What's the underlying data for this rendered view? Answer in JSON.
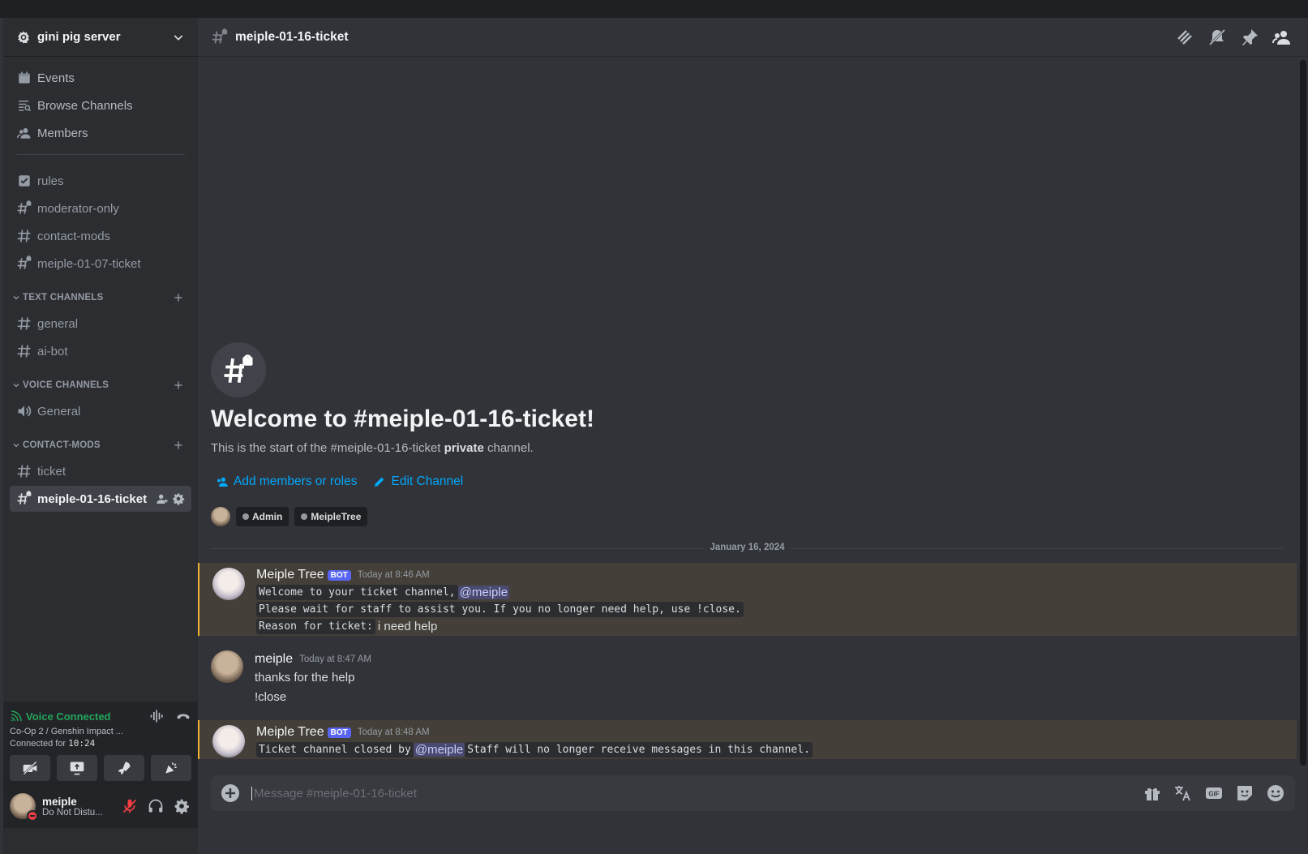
{
  "server": {
    "name": "gini pig server"
  },
  "nav": {
    "top_items": [
      {
        "label": "Events",
        "icon": "calendar-icon"
      },
      {
        "label": "Browse Channels",
        "icon": "browse-channels-icon"
      },
      {
        "label": "Members",
        "icon": "members-icon"
      }
    ],
    "channels": [
      {
        "label": "rules",
        "icon": "rules-icon"
      },
      {
        "label": "moderator-only",
        "icon": "locked-hash-icon"
      },
      {
        "label": "contact-mods",
        "icon": "hash-icon"
      },
      {
        "label": "meiple-01-07-ticket",
        "icon": "locked-hash-icon"
      }
    ],
    "categories": {
      "text": {
        "label": "TEXT CHANNELS",
        "channels": [
          "general",
          "ai-bot"
        ]
      },
      "voice": {
        "label": "VOICE CHANNELS",
        "channels": [
          "General"
        ]
      },
      "contact": {
        "label": "CONTACT-MODS",
        "channels": [
          "ticket",
          "meiple-01-16-ticket"
        ]
      }
    }
  },
  "voice": {
    "status": "Voice Connected",
    "channel": "Co-Op 2 / Genshin Impact ...",
    "connected_label": "Connected for ",
    "connected_time": "10:24"
  },
  "user": {
    "name": "meiple",
    "status": "Do Not Distu..."
  },
  "channel": {
    "name": "meiple-01-16-ticket",
    "welcome_title": "Welcome to #meiple-01-16-ticket!",
    "welcome_sub_pre": "This is the start of the #meiple-01-16-ticket ",
    "welcome_sub_bold": "private",
    "welcome_sub_post": " channel.",
    "add_members": "Add members or roles",
    "edit_channel": "Edit Channel",
    "roles": [
      "Admin",
      "MeipleTree"
    ]
  },
  "date_separator": "January 16, 2024",
  "messages": [
    {
      "author": "Meiple Tree",
      "badge": "BOT",
      "time": "Today at 8:46 AM",
      "l1_code": "Welcome to your ticket channel,",
      "l1_mention": "@meiple",
      "l2_code": "Please wait for staff to assist you. If you no longer need help, use !close.",
      "l3_code": "Reason for ticket:",
      "l3_text": "i need help"
    },
    {
      "author": "meiple",
      "time": "Today at 8:47 AM",
      "l1_text": "thanks for the help",
      "l2_text": "!close"
    },
    {
      "author": "Meiple Tree",
      "badge": "BOT",
      "time": "Today at 8:48 AM",
      "l1_code_pre": "Ticket channel closed by",
      "l1_mention": "@meiple",
      "l1_code_post": "Staff will no longer receive messages in this channel."
    }
  ],
  "composer": {
    "placeholder": "Message #meiple-01-16-ticket"
  },
  "colors": {
    "accent": "#5865f2",
    "link": "#00a8fc",
    "voice_green": "#23a55a",
    "dnd_red": "#f23f43",
    "highlight_bar": "#f0b232"
  }
}
